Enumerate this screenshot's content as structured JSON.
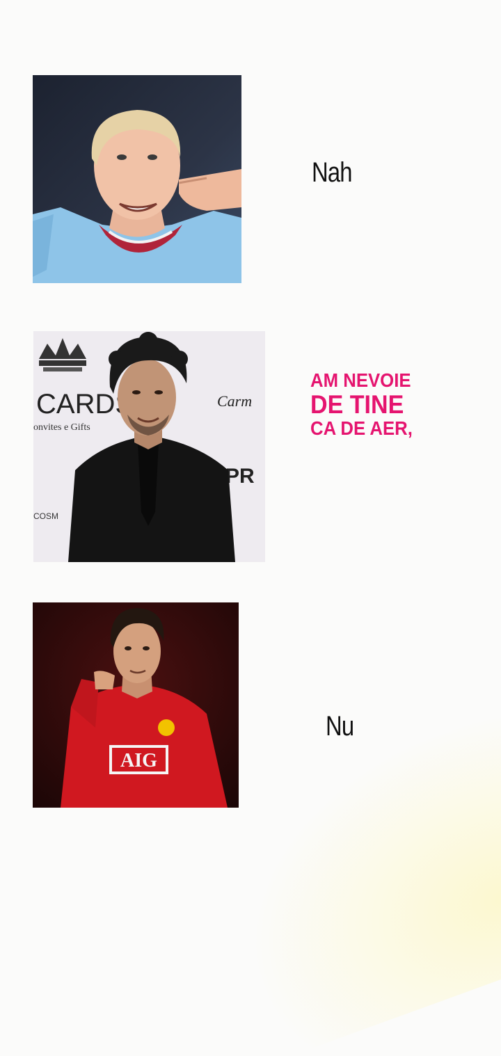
{
  "panels": [
    {
      "caption": "Nah",
      "image_alt": "Smiling blond footballer in light blue shirt pointing to his head"
    },
    {
      "caption_lines": [
        "AM NEVOIE",
        "DE TINE",
        "CA DE AER,"
      ],
      "image_alt": "Footballer with curly dark hair in black suit in front of a sponsor backdrop",
      "backdrop_text": [
        "CARDS",
        "onvites e Gifts",
        "Carm",
        "PR",
        "COSM"
      ]
    },
    {
      "caption": "Nu",
      "image_alt": "Footballer in red AIG jersey pointing at the camera",
      "jersey_text": "AIG"
    }
  ],
  "colors": {
    "background": "#fbfbfa",
    "caption_text": "#111111",
    "accent_pink": "#e5146f"
  }
}
